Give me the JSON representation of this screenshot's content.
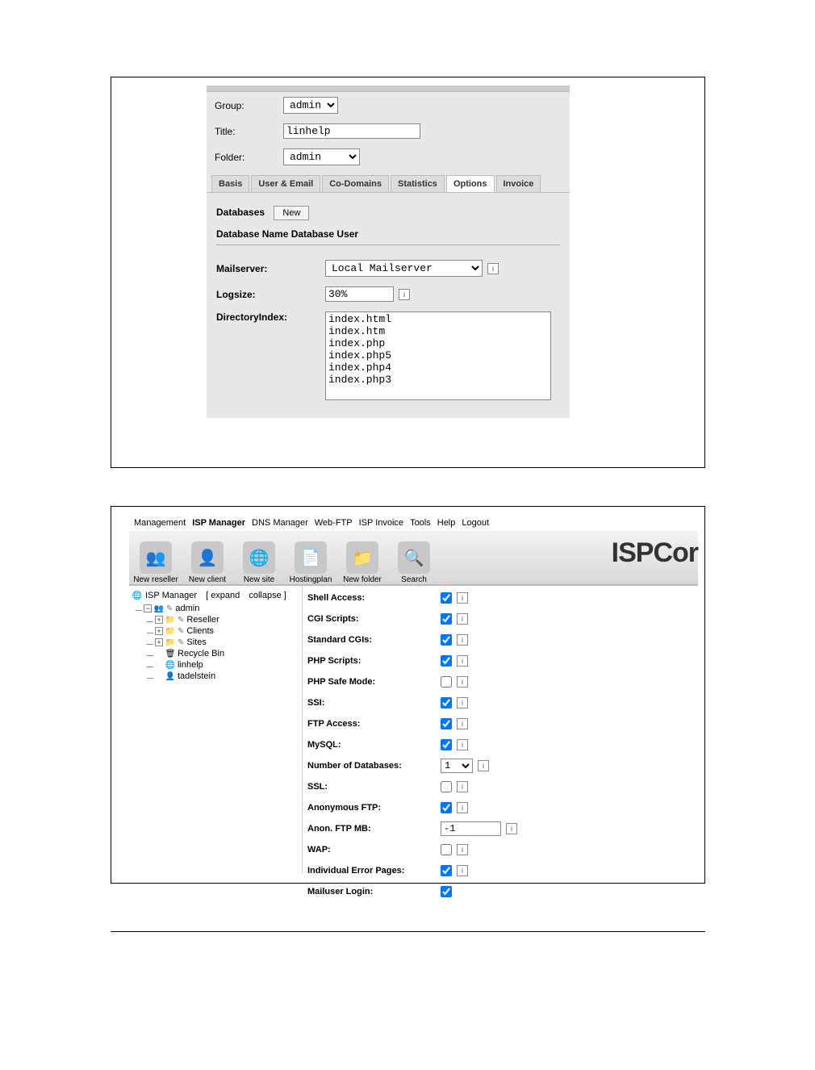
{
  "panel1": {
    "group_label": "Group:",
    "group_value": "admin",
    "title_label": "Title:",
    "title_value": "linhelp",
    "folder_label": "Folder:",
    "folder_value": "admin",
    "tabs": {
      "basis": "Basis",
      "user_email": "User & Email",
      "co_domains": "Co-Domains",
      "statistics": "Statistics",
      "options": "Options",
      "invoice": "Invoice"
    },
    "databases_label": "Databases",
    "new_button": "New",
    "table_header": "Database Name  Database User",
    "mailserver_label": "Mailserver:",
    "mailserver_value": "Local Mailserver",
    "logsize_label": "Logsize:",
    "logsize_value": "30%",
    "dirindex_label": "DirectoryIndex:",
    "dirindex_value": "index.html\nindex.htm\nindex.php\nindex.php5\nindex.php4\nindex.php3"
  },
  "panel2": {
    "menu": {
      "management": "Management",
      "isp_manager": "ISP Manager",
      "dns_manager": "DNS Manager",
      "web_ftp": "Web-FTP",
      "isp_invoice": "ISP Invoice",
      "tools": "Tools",
      "help": "Help",
      "logout": "Logout"
    },
    "toolbar": {
      "new_reseller": "New reseller",
      "new_client": "New client",
      "new_site": "New site",
      "hostingplan": "Hostingplan",
      "new_folder": "New folder",
      "search": "Search"
    },
    "brand": "ISPCor",
    "tree": {
      "root": "ISP Manager",
      "expand": "[ expand",
      "collapse": "collapse ]",
      "admin": "admin",
      "reseller": "Reseller",
      "clients": "Clients",
      "sites": "Sites",
      "recycle_bin": "Recycle Bin",
      "linhelp": "linhelp",
      "tadelstein": "tadelstein"
    },
    "props": {
      "shell_access": "Shell Access:",
      "cgi_scripts": "CGI Scripts:",
      "standard_cgis": "Standard CGIs:",
      "php_scripts": "PHP Scripts:",
      "php_safe_mode": "PHP Safe Mode:",
      "ssi": "SSI:",
      "ftp_access": "FTP Access:",
      "mysql": "MySQL:",
      "num_db": "Number of Databases:",
      "ssl": "SSL:",
      "anon_ftp": "Anonymous FTP:",
      "anon_ftp_mb": "Anon. FTP MB:",
      "wap": "WAP:",
      "error_pages": "Individual Error Pages:",
      "mailuser": "Mailuser Login:"
    },
    "values": {
      "num_db": "1",
      "anon_ftp_mb": "-1"
    }
  }
}
